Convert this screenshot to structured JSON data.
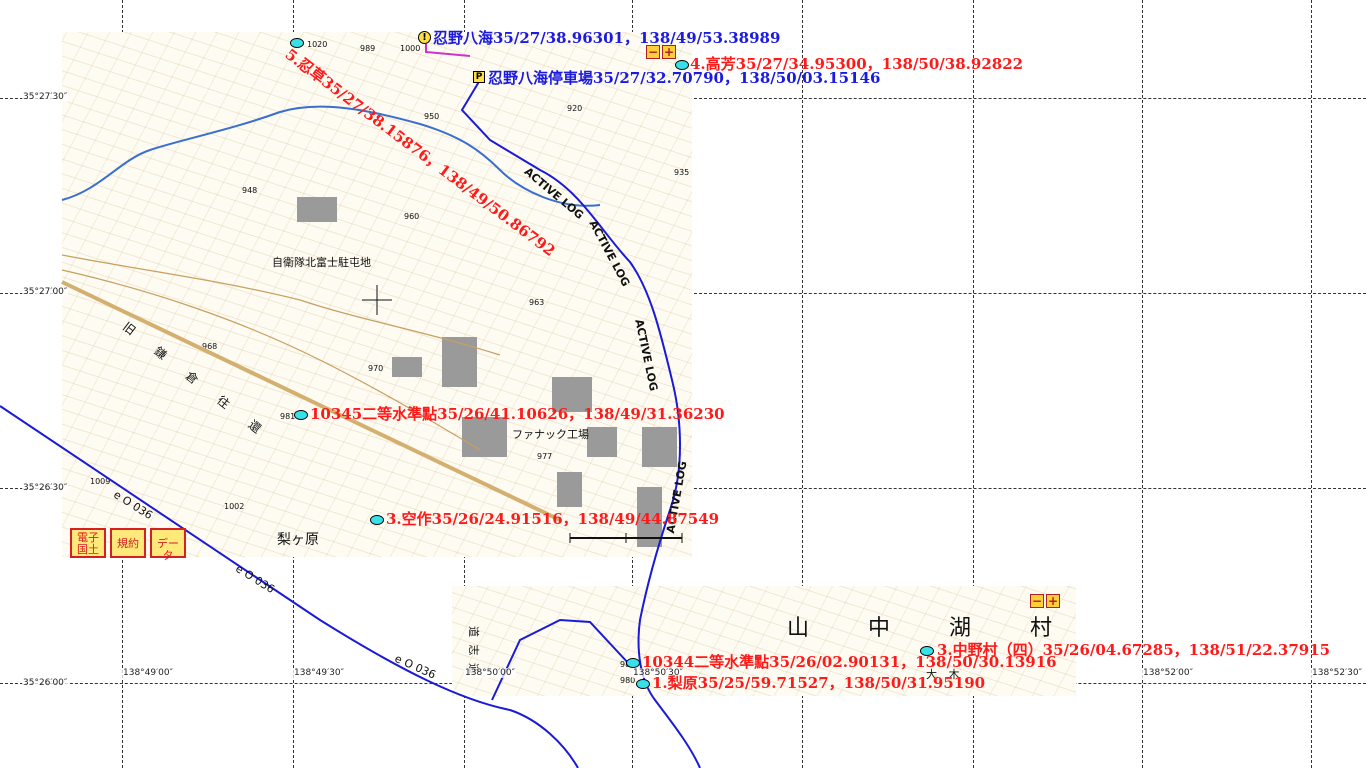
{
  "map_tiles": {
    "upper_left_place": "自衛隊北富士駐屯地",
    "upper_left_factory": "ファナック工場",
    "upper_left_area": "梨ヶ原",
    "upper_left_road": "旧 鎌 倉 往 還",
    "lower_village": "山 中 湖 村",
    "lower_road": "道 志 道",
    "lower_area": "大 木"
  },
  "buttons": {
    "denshi_kokudo": "電子国土",
    "kiyaku": "規約",
    "data": "データ",
    "zoom_minus": "−",
    "zoom_plus": "+"
  },
  "track_labels": {
    "active_log": "ACTIVE LOG",
    "route_036": "e O 036"
  },
  "grid": {
    "lat": [
      "35°27′30″",
      "35°27′00″",
      "35°26′30″",
      "35°26′00″"
    ],
    "lon": [
      "138°49′00″",
      "138°49′30″",
      "138°50′00″",
      "138°50′30″",
      "138°52′00″",
      "138°52′30″"
    ]
  },
  "waypoints": [
    {
      "label": "忍野八海35/27/38.96301，138/49/53.38989",
      "color": "blue"
    },
    {
      "label": "4.高芳35/27/34.95300，138/50/38.92822",
      "color": "red"
    },
    {
      "label": "忍野八海停車場35/27/32.70790，138/50/03.15146",
      "color": "blue"
    },
    {
      "label": "5.忍草35/27/38.15876，138/49/50.86792",
      "color": "red"
    },
    {
      "label": "10345二等水準點35/26/41.10626，138/49/31.36230",
      "color": "red"
    },
    {
      "label": "3.空作35/26/24.91516，138/49/44.87549",
      "color": "red"
    },
    {
      "label": "3.中野村（四）35/26/04.67285，138/51/22.37915",
      "color": "red"
    },
    {
      "label": "10344二等水準點35/26/02.90131，138/50/30.13916",
      "color": "red"
    },
    {
      "label": "1.梨原35/25/59.71527，138/50/31.95190",
      "color": "red"
    }
  ],
  "spot_heights": [
    "1020",
    "989",
    "1000",
    "950",
    "920",
    "948",
    "960",
    "935",
    "968",
    "970",
    "963",
    "981",
    "977",
    "1009",
    "1002",
    "989",
    "980"
  ],
  "colors": {
    "track": "#1a1ad8",
    "label_red": "#ff1a1a",
    "label_blue": "#1a1ae0",
    "marker": "#38e0e8",
    "river": "#3a6fd0",
    "contour": "#c8a060"
  }
}
